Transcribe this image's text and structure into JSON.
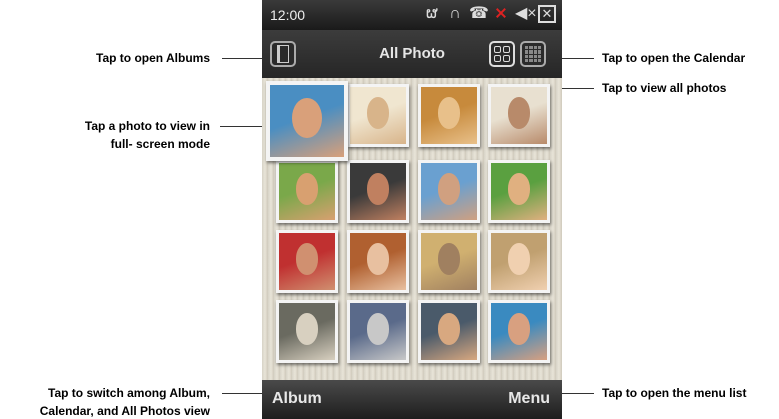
{
  "callouts": {
    "albums": "Tap to open Albums",
    "calendar": "Tap to open the Calendar",
    "all_photos": "Tap to view all photos",
    "photo_line1": "Tap a photo to view in",
    "photo_line2": "full- screen mode",
    "switch_line1": "Tap to switch among Album,",
    "switch_line2": "Calendar, and All Photos view",
    "menu_list": "Tap to open the menu list"
  },
  "statusbar": {
    "time": "12:00",
    "icons": [
      "bluetooth-icon",
      "headset-icon",
      "call-alert-icon",
      "no-signal-icon",
      "speaker-muted-icon",
      "close-icon"
    ]
  },
  "titlebar": {
    "title": "All Photo"
  },
  "photos": [
    {
      "colors": [
        "#4a8ec2",
        "#d9a07a"
      ]
    },
    {
      "colors": [
        "#f0e6d0",
        "#d8b48a"
      ]
    },
    {
      "colors": [
        "#c78a3c",
        "#e8c08a"
      ]
    },
    {
      "colors": [
        "#e8e0d0",
        "#b88a6a"
      ]
    },
    {
      "colors": [
        "#7aa84a",
        "#d8a070"
      ]
    },
    {
      "colors": [
        "#3a3a3a",
        "#c08060"
      ]
    },
    {
      "colors": [
        "#6aa0d0",
        "#d0a080"
      ]
    },
    {
      "colors": [
        "#5aa040",
        "#e0b080"
      ]
    },
    {
      "colors": [
        "#c03030",
        "#d09070"
      ]
    },
    {
      "colors": [
        "#b06030",
        "#e8c0a0"
      ]
    },
    {
      "colors": [
        "#d0b070",
        "#a08060"
      ]
    },
    {
      "colors": [
        "#c0a070",
        "#f0d0b0"
      ]
    },
    {
      "colors": [
        "#6a6a60",
        "#d8d0c0"
      ]
    },
    {
      "colors": [
        "#5a6a8a",
        "#c8c8c8"
      ]
    },
    {
      "colors": [
        "#4a5a6a",
        "#d8a880"
      ]
    },
    {
      "colors": [
        "#3a8ac0",
        "#d8a080"
      ]
    }
  ],
  "softkeys": {
    "left": "Album",
    "right": "Menu"
  }
}
